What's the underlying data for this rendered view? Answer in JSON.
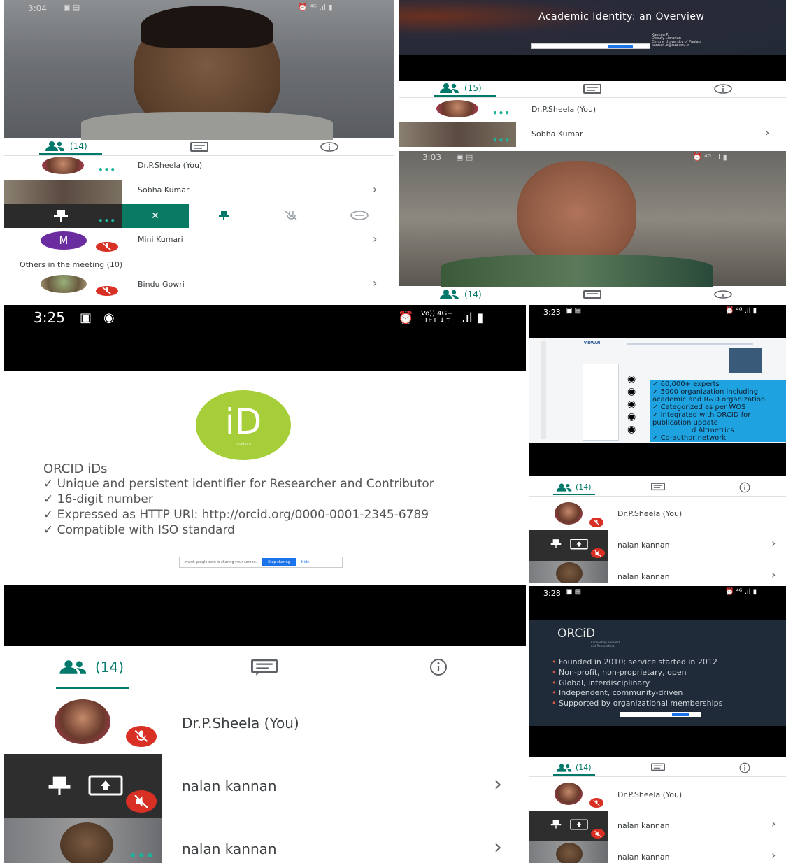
{
  "p1": {
    "status_time": "3:04",
    "tabs": {
      "participants": "(14)"
    },
    "rows": [
      {
        "name": "Dr.P.Sheela (You)"
      },
      {
        "name": "Sobha Kumar"
      },
      {
        "name": "Mini Kumari",
        "initial": "M"
      },
      {
        "name": "Bindu Gowri"
      }
    ],
    "others_label": "Others in the meeting (10)",
    "actions": {
      "close": "✕"
    }
  },
  "p2": {
    "slide_title": "Academic Identity: an Overview",
    "slide_author": [
      "Kannan P.",
      "Deputy Librarian",
      "Central University of Punjab",
      "kannan.p@cup.edu.in"
    ],
    "tabs": {
      "participants": "(15)"
    },
    "rows": [
      {
        "name": "Dr.P.Sheela (You)"
      },
      {
        "name": "Sobha Kumar"
      }
    ]
  },
  "p3": {
    "status_time": "3:03",
    "tabs": {
      "participants": "(14)"
    }
  },
  "p4": {
    "status_time": "3:25",
    "status_net": [
      "Vo)) 4G+",
      "LTE1 ↓↑"
    ],
    "orcid_logo_text": "iD",
    "orcid_logo_sub": "orcid.org",
    "slide_heading": "ORCID iDs",
    "bullets": [
      "Unique and persistent identifier for Researcher and Contributor",
      "16-digit number",
      "Expressed as HTTP URI: http://orcid.org/0000-0001-2345-6789",
      "Compatible with ISO standard"
    ],
    "share_bar": {
      "text": "meet.google.com is sharing your screen.",
      "stop": "Stop sharing",
      "hide": "Hide"
    },
    "tabs": {
      "participants": "(14)"
    },
    "rows": [
      {
        "name": "Dr.P.Sheela (You)"
      },
      {
        "name": "nalan kannan"
      },
      {
        "name": "nalan kannan"
      }
    ]
  },
  "p5": {
    "status_time": "3:23",
    "site_logo": "VIDWAN",
    "bullets": [
      "60,000+ experts",
      "5000 organization including academic and R&D organization",
      "Categorized as per WOS",
      "Integrated with ORCID for publication update",
      "d Altmetrics",
      "Co-author network"
    ],
    "tabs": {
      "participants": "(14)"
    },
    "rows": [
      {
        "name": "Dr.P.Sheela (You)"
      },
      {
        "name": "nalan kannan"
      },
      {
        "name": "nalan kannan"
      }
    ]
  },
  "p6": {
    "status_time": "3:28",
    "orcid_word": "ORCiD",
    "orcid_tag": [
      "Connecting Research",
      "and Researchers"
    ],
    "bullets": [
      "Founded in 2010; service started in 2012",
      "Non-profit, non-proprietary, open",
      "Global, interdisciplinary",
      "Independent, community-driven",
      "Supported by organizational memberships"
    ],
    "tabs": {
      "participants": "(14)"
    },
    "rows": [
      {
        "name": "Dr.P.Sheela (You)"
      },
      {
        "name": "nalan kannan"
      },
      {
        "name": "nalan kannan"
      }
    ]
  },
  "icons": {
    "chevron": "›",
    "people": "people-icon",
    "chat": "chat-icon",
    "info": "info-icon"
  },
  "colors": {
    "accent": "#00796b",
    "mic_off": "#d93025",
    "orcid_green": "#a6ce39",
    "share_blue": "#1a73e8"
  }
}
